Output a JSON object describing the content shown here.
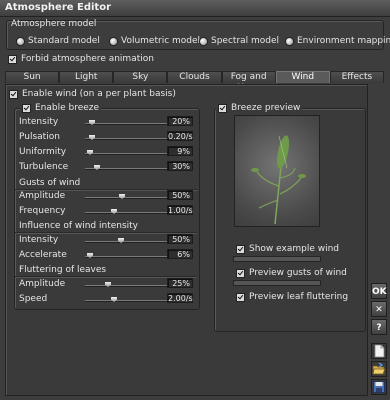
{
  "window": {
    "title": "Atmosphere Editor"
  },
  "model": {
    "group_title": "Atmosphere model",
    "options": [
      "Standard model",
      "Volumetric model",
      "Spectral model",
      "Environment mapping"
    ]
  },
  "forbid_animation_label": "Forbid atmosphere animation",
  "tabs": [
    "Sun",
    "Light",
    "Sky",
    "Clouds",
    "Fog and Haze",
    "Wind",
    "Effects"
  ],
  "enable_wind_label": "Enable wind (on a per plant basis)",
  "breeze": {
    "enable_label": "Enable breeze",
    "rows": [
      {
        "label": "Intensity",
        "value": "20%",
        "pos": 0.05
      },
      {
        "label": "Pulsation",
        "value": "0.20/s",
        "pos": 0.05
      },
      {
        "label": "Uniformity",
        "value": "9%",
        "pos": 0.03
      },
      {
        "label": "Turbulence",
        "value": "30%",
        "pos": 0.12
      }
    ]
  },
  "gusts": {
    "title": "Gusts of wind",
    "rows": [
      {
        "label": "Amplitude",
        "value": "50%",
        "pos": 0.43
      },
      {
        "label": "Frequency",
        "value": "1.00/s",
        "pos": 0.33
      }
    ]
  },
  "influence": {
    "title": "Influence of wind intensity",
    "rows": [
      {
        "label": "Intensity",
        "value": "50%",
        "pos": 0.42
      },
      {
        "label": "Accelerate",
        "value": "6%",
        "pos": 0.03
      }
    ]
  },
  "fluttering": {
    "title": "Fluttering of leaves",
    "rows": [
      {
        "label": "Amplitude",
        "value": "25%",
        "pos": 0.25
      },
      {
        "label": "Speed",
        "value": "2.00/s",
        "pos": 0.33
      }
    ]
  },
  "preview": {
    "title": "Breeze preview",
    "show_example_label": "Show example wind",
    "preview_gusts_label": "Preview gusts of wind",
    "preview_flutter_label": "Preview leaf fluttering"
  },
  "side_buttons": {
    "ok": "OK",
    "cancel": "✕",
    "help": "?"
  }
}
